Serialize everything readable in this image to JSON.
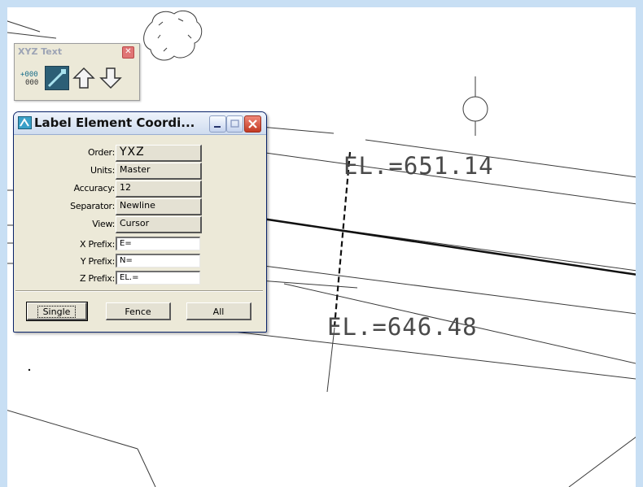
{
  "toolbar": {
    "title": "XYZ Text",
    "close_icon": "close-icon",
    "tools": [
      {
        "name": "place-coordinate-text-icon",
        "glyph": "+000 000"
      },
      {
        "name": "label-line-icon"
      },
      {
        "name": "increment-up-arrow-icon"
      },
      {
        "name": "decrement-down-arrow-icon"
      }
    ]
  },
  "dialog": {
    "title": "Label Element Coordi...",
    "rows": [
      {
        "label": "Order:",
        "value": "YXZ"
      },
      {
        "label": "Units:",
        "value": "Master"
      },
      {
        "label": "Accuracy:",
        "value": "12"
      },
      {
        "label": "Separator:",
        "value": "Newline"
      },
      {
        "label": "View:",
        "value": "Cursor"
      }
    ],
    "fields": [
      {
        "label": "X Prefix:",
        "value": "E="
      },
      {
        "label": "Y Prefix:",
        "value": "N="
      },
      {
        "label": "Z Prefix:",
        "value": "EL.="
      }
    ],
    "buttons": {
      "single": "Single",
      "fence": "Fence",
      "all": "All"
    }
  },
  "drawing": {
    "labels": [
      "EL.=651.14",
      "EL.=646.48"
    ]
  },
  "colors": {
    "frame": "#c8dff4",
    "title_close": "#c23a23",
    "toolbar_active": "#2c5f76"
  }
}
